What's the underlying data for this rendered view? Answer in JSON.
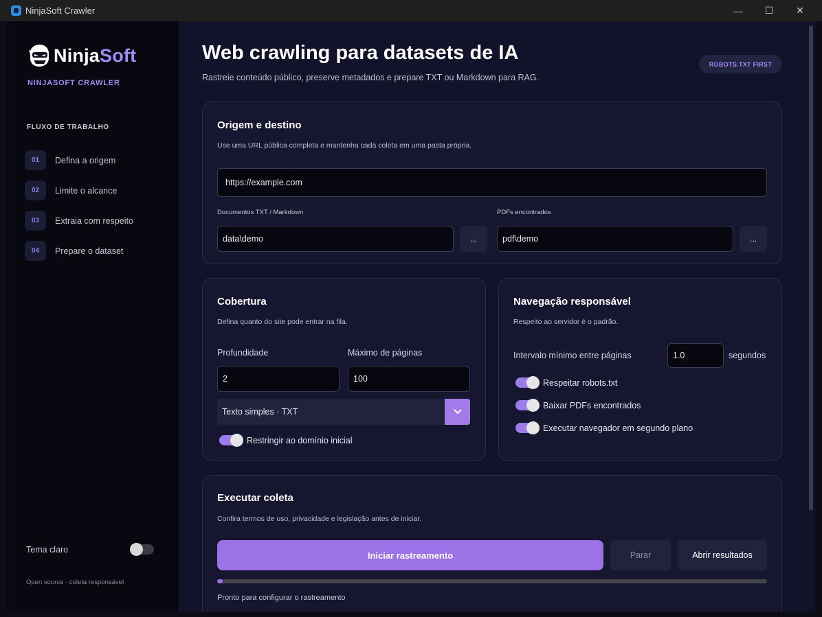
{
  "window": {
    "title": "NinjaSoft Crawler",
    "minimize": "—",
    "maximize": "☐",
    "close": "✕"
  },
  "sidebar": {
    "logo_ninja": "Ninja",
    "logo_soft": "Soft",
    "brand": "NINJASOFT CRAWLER",
    "flow_heading": "FLUXO DE TRABALHO",
    "steps": [
      {
        "num": "01",
        "label": "Defina a origem"
      },
      {
        "num": "02",
        "label": "Limite o alcance"
      },
      {
        "num": "03",
        "label": "Extraia com respeito"
      },
      {
        "num": "04",
        "label": "Prepare o dataset"
      }
    ],
    "theme_label": "Tema claro",
    "theme_light_on": false,
    "footer": "Open source · coleta responsável"
  },
  "header": {
    "title": "Web crawling para datasets de IA",
    "subtitle": "Rastreie conteúdo público, preserve metadados e prepare TXT ou Markdown para RAG.",
    "badge": "ROBOTS.TXT FIRST"
  },
  "origin": {
    "title": "Origem e destino",
    "desc": "Use uma URL pública completa e mantenha cada coleta em uma pasta própria.",
    "url_value": "https://example.com",
    "docs_label": "Documentos TXT / Markdown",
    "docs_value": "data\\demo",
    "pdfs_label": "PDFs encontrados",
    "pdfs_value": "pdf\\demo",
    "browse_label": "..."
  },
  "coverage": {
    "title": "Cobertura",
    "desc": "Defina quanto do site pode entrar na fila.",
    "depth_label": "Profundidade",
    "depth_value": "2",
    "max_pages_label": "Máximo de páginas",
    "max_pages_value": "100",
    "format_value": "Texto simples · TXT",
    "restrict_label": "Restringir ao domínio inicial",
    "restrict_on": true
  },
  "navigation": {
    "title": "Navegação responsável",
    "desc": "Respeito ao servidor é o padrão.",
    "interval_label": "Intervalo mínimo entre páginas",
    "interval_value": "1.0",
    "interval_unit": "segundos",
    "robots_label": "Respeitar robots.txt",
    "robots_on": true,
    "pdfs_label": "Baixar PDFs encontrados",
    "pdfs_on": true,
    "headless_label": "Executar navegador em segundo plano",
    "headless_on": true
  },
  "run": {
    "title": "Executar coleta",
    "desc": "Confira termos de uso, privacidade e legislação antes de iniciar.",
    "start_label": "Iniciar rastreamento",
    "stop_label": "Parar",
    "open_label": "Abrir resultados",
    "progress_percent": 1,
    "status": "Pronto para configurar o rastreamento"
  },
  "colors": {
    "accent": "#9c73e6",
    "sidebar_bg": "#080810",
    "main_bg": "#12122a",
    "card_bg": "#161630"
  }
}
